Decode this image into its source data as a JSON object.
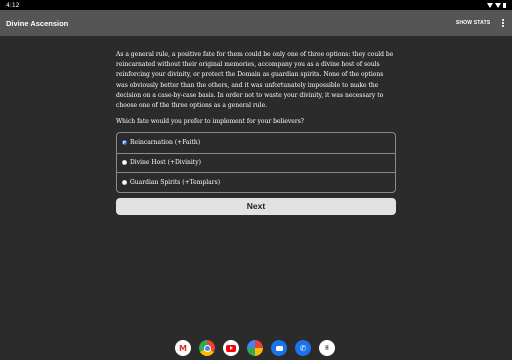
{
  "status_bar": {
    "time": "4:12"
  },
  "app_bar": {
    "title": "Divine Ascension",
    "show_stats_label": "SHOW STATS"
  },
  "main": {
    "passage": "As a general rule, a positive fate for them could be only one of three options: they could be reincarnated without their original memories, accompany you as a divine host of souls reinforcing your divinity, or protect the Domain as guardian spirits. None of the options was obviously better than the others, and it was unfortunately impossible to make the decision on a case-by-case basis. In order not to waste your divinity, it was necessary to choose one of the three options as a general rule.",
    "question": "Which fate would you prefer to implement for your believers?",
    "choices": [
      {
        "label": "Reincarnation (+Faith)",
        "selected": true
      },
      {
        "label": "Divine Host (+Divinity)",
        "selected": false
      },
      {
        "label": "Guardian Spirits (+Templars)",
        "selected": false
      }
    ],
    "next_label": "Next"
  },
  "dock": {
    "apps": [
      "gmail-icon",
      "chrome-icon",
      "youtube-icon",
      "photos-icon",
      "messages-icon",
      "phone-icon",
      "app-drawer-icon"
    ]
  },
  "colors": {
    "background": "#2b2b2b",
    "app_bar": "#555555",
    "radio_selected": "#3b6ed6",
    "next_button": "#e2e2e2"
  }
}
